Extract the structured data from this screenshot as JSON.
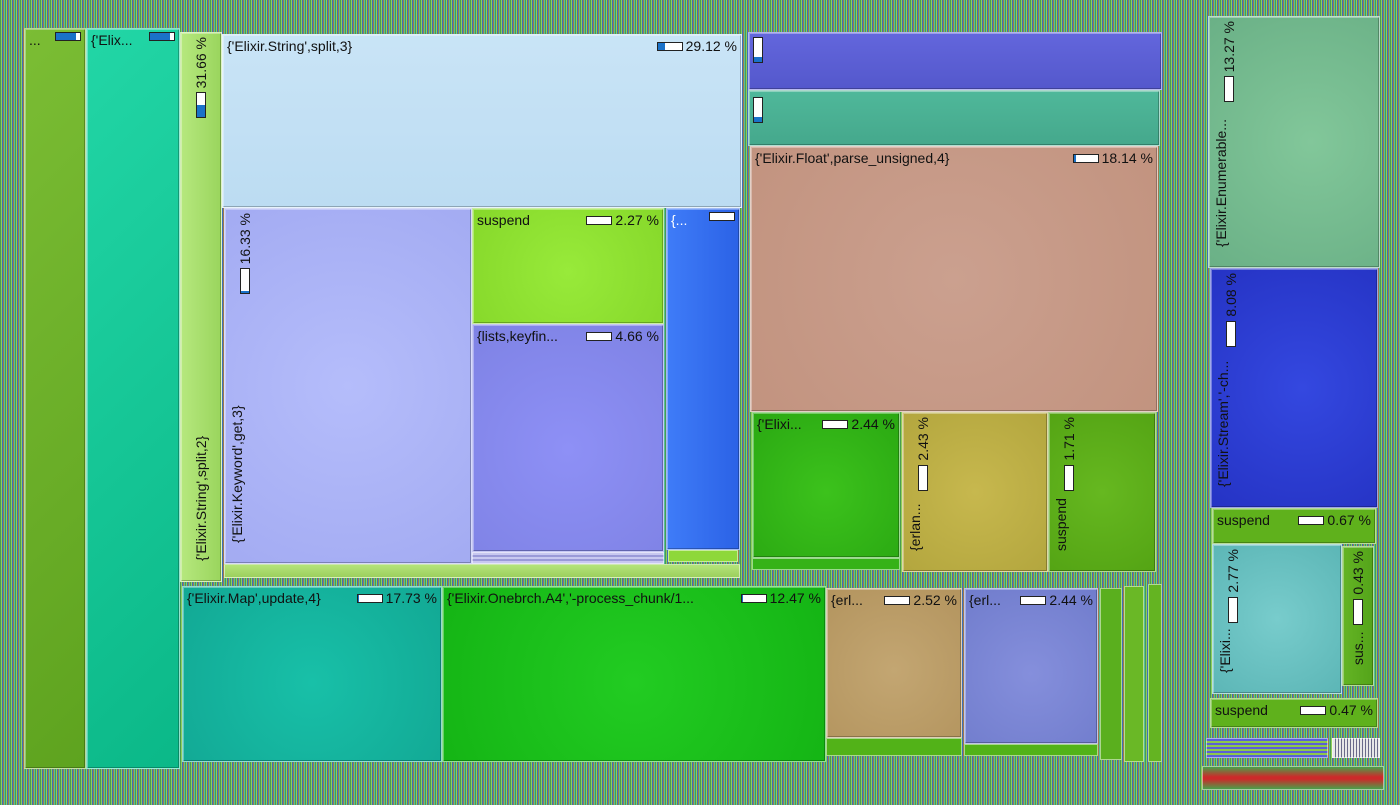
{
  "colors": {
    "outer": "#6fb02a",
    "teal": "#10c995",
    "lightgreen": "#a9e070",
    "lightblue": "#c3e1f5",
    "lavender": "#a7aef6",
    "limegreen": "#8ee02e",
    "violet": "#8c8ef0",
    "blue": "#2d6cf0",
    "indigo": "#5b5fd6",
    "seagreen": "#49b394",
    "salmon": "#c89a88",
    "green": "#34b31a",
    "olive": "#bdaf4a",
    "grassgreen": "#5db019",
    "mapteal": "#16b8a2",
    "brightgreen": "#1ec81e",
    "tan": "#bda06a",
    "slateblue": "#7d87d4",
    "sage": "#7cbf93",
    "royalblue": "#2f3dd2",
    "aqua": "#6cc2c2"
  },
  "blocks": {
    "root": {
      "label": "...",
      "bar": 0.85
    },
    "elix1": {
      "label": "{'Elix...",
      "bar": 0.85
    },
    "strsplit2": {
      "label": "{'Elixir.String',split,2}",
      "pct": "31.66 %",
      "bar": 0.5
    },
    "strsplit3": {
      "label": "{'Elixir.String',split,3}",
      "pct": "29.12 %",
      "bar": 0.3
    },
    "keyword": {
      "label": "{'Elixir.Keyword',get,3}",
      "pct": "16.33 %",
      "bar": 0.1
    },
    "suspend1": {
      "label": "suspend",
      "pct": "2.27 %",
      "bar": 0.0
    },
    "lists": {
      "label": "{lists,keyfin...",
      "pct": "4.66 %",
      "bar": 0.0
    },
    "blue1": {
      "label": "{...",
      "bar": 0.0
    },
    "float": {
      "label": "{'Elixir.Float',parse_unsigned,4}",
      "pct": "18.14 %",
      "bar": 0.1
    },
    "elixi1": {
      "label": "{'Elixi...",
      "pct": "2.44 %",
      "bar": 0.0
    },
    "erlan1": {
      "label": "{erlan...",
      "pct": "2.43 %",
      "bar": 0.0
    },
    "suspend2": {
      "label": "suspend",
      "pct": "1.71 %",
      "bar": 0.0
    },
    "map": {
      "label": "{'Elixir.Map',update,4}",
      "pct": "17.73 %",
      "bar": 0.05
    },
    "onebrch": {
      "label": "{'Elixir.Onebrch.A4','-process_chunk/1...",
      "pct": "12.47 %",
      "bar": 0.05
    },
    "erl1": {
      "label": "{erl...",
      "pct": "2.52 %",
      "bar": 0.0
    },
    "erl2": {
      "label": "{erl...",
      "pct": "2.44 %",
      "bar": 0.0
    },
    "enumerable": {
      "label": "{'Elixir.Enumerable...",
      "pct": "13.27 %",
      "bar": 0.0
    },
    "stream": {
      "label": "{'Elixir.Stream','-ch...",
      "pct": "8.08 %",
      "bar": 0.0
    },
    "suspend3": {
      "label": "suspend",
      "pct": "0.67 %",
      "bar": 0.0
    },
    "elixi2": {
      "label": "{'Elixi...",
      "pct": "2.77 %",
      "bar": 0.0
    },
    "sus": {
      "label": "sus...",
      "pct": "0.43 %",
      "bar": 0.0
    },
    "suspend4": {
      "label": "suspend",
      "pct": "0.47 %",
      "bar": 0.0
    }
  }
}
